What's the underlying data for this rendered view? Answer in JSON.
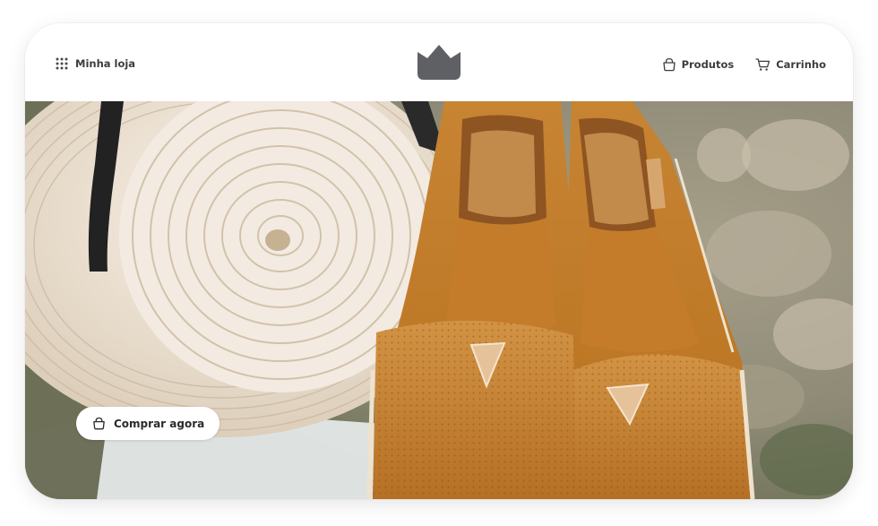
{
  "header": {
    "menu": {
      "label": "Minha loja",
      "icon": "grid-dots-icon"
    },
    "logo": {
      "icon": "crown-icon",
      "color": "#5f6064"
    },
    "nav": [
      {
        "label": "Produtos",
        "icon": "shopping-bag-icon"
      },
      {
        "label": "Carrinho",
        "icon": "shopping-cart-icon"
      }
    ]
  },
  "hero": {
    "cta": {
      "label": "Comprar agora",
      "icon": "shopping-bag-icon"
    }
  },
  "colors": {
    "text": "#3d3d3d",
    "logo": "#5f6064",
    "espadrille": "#c8822e",
    "straw": "#e8dccd"
  }
}
